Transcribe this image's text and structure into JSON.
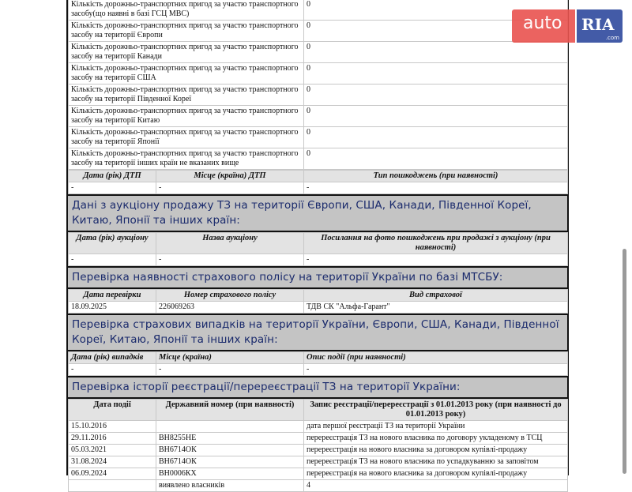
{
  "accidents": [
    {
      "label": "Кількість дорожньо-транспортних пригод за участю транспортного засобу(що наявні в базі ГСЦ МВС)",
      "value": "0"
    },
    {
      "label": "Кількість дорожньо-транспортних пригод за участю транспортного засобу на території Європи",
      "value": "0"
    },
    {
      "label": "Кількість дорожньо-транспортних пригод за участю транспортного засобу на території Канади",
      "value": "0"
    },
    {
      "label": "Кількість дорожньо-транспортних пригод за участю транспортного засобу на території США",
      "value": "0"
    },
    {
      "label": "Кількість дорожньо-транспортних пригод за участю транспортного засобу на території Південної Кореї",
      "value": "0"
    },
    {
      "label": "Кількість дорожньо-транспортних пригод за участю транспортного засобу на території Китаю",
      "value": "0"
    },
    {
      "label": "Кількість дорожньо-транспортних пригод за участю транспортного засобу на території Японії",
      "value": "0"
    },
    {
      "label": "Кількість дорожньо-транспортних пригод за участю транспортного засобу на території інших країн не вказаних вище",
      "value": "0"
    }
  ],
  "dtp_table": {
    "headers": [
      "Дата (рік) ДТП",
      "Місце (країна) ДТП",
      "Тип пошкоджень (при наявності)"
    ],
    "row": [
      "-",
      "-",
      "-"
    ]
  },
  "auction": {
    "title": "Дані з аукціону продажу ТЗ на території Європи, США, Канади, Південної Кореї, Китаю, Японії та інших країн:",
    "headers": [
      "Дата (рік) аукціону",
      "Назва аукціону",
      "Посилання на фото пошкоджень при продажі з аукціону (при наявності)"
    ],
    "row": [
      "-",
      "-",
      "-"
    ]
  },
  "insurance": {
    "title": "Перевірка наявності страхового полісу на території України по базі МТСБУ:",
    "headers": [
      "Дата перевірки",
      "Номер страхового полісу",
      "Вид страхової"
    ],
    "row": [
      "18.09.2025",
      "226069263",
      "ТДВ СК \"Альфа-Гарант\""
    ]
  },
  "claims": {
    "title": "Перевірка страхових випадків на території України, Європи, США, Канади, Південної Кореї, Китаю, Японії та інших країн:",
    "headers": [
      "Дата (рік) випадків",
      "Місце (країна)",
      "Опис події (при наявності)"
    ],
    "row": [
      "-",
      "-",
      "-"
    ]
  },
  "registration": {
    "title": "Перевірка історії реєстрації/перереєстрації ТЗ на території України:",
    "headers": [
      "Дата події",
      "Державний номер (при наявності)",
      "Запис реєстрації/перереєстрації з 01.01.2013 року (при наявності до 01.01.2013 року)"
    ],
    "rows": [
      [
        "15.10.2016",
        "",
        "дата першої реєстрації ТЗ на території України"
      ],
      [
        "29.11.2016",
        "ВН8255НЕ",
        "перереєстрація ТЗ на нового власника по договору укладеному в ТСЦ"
      ],
      [
        "05.03.2021",
        "ВН6714ОК",
        "перереєстрація на нового власника за договором купівлі-продажу"
      ],
      [
        "31.08.2024",
        "ВН6714ОК",
        "перереєстрація ТЗ на нового власника по успадкуванню за заповітом"
      ],
      [
        "06.09.2024",
        "ВН0006КХ",
        "перереєстрація на нового власника за договором купівлі-продажу"
      ]
    ],
    "owners_label": "виявлено власників",
    "owners_count": "4"
  },
  "watermark": {
    "left": "auto",
    "right": "RIA",
    "suffix": ".com"
  }
}
